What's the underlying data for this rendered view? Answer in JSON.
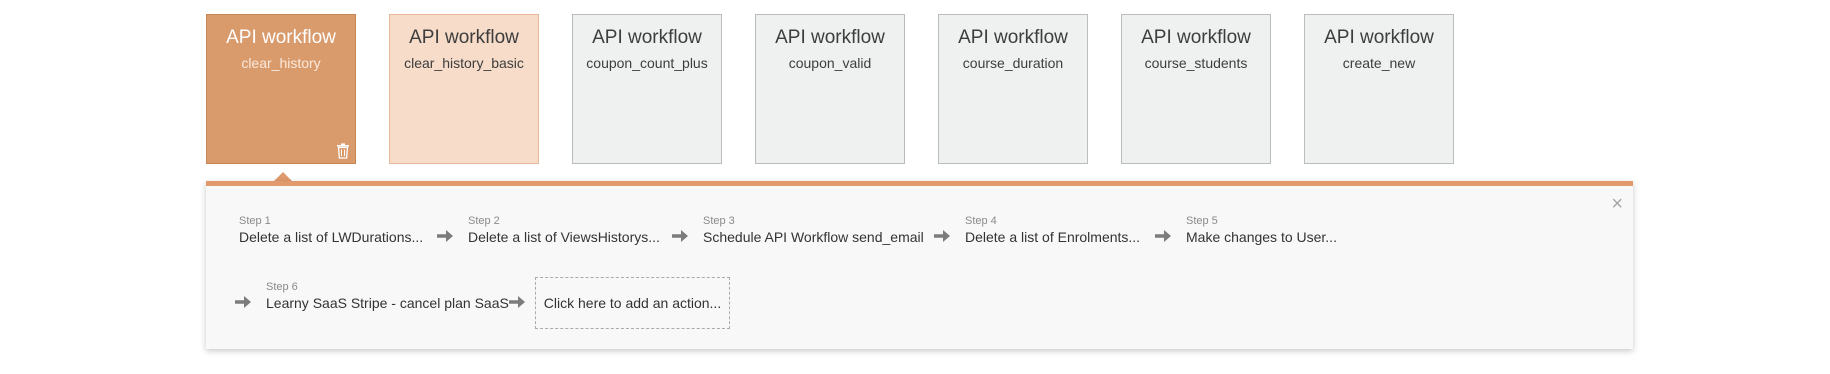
{
  "workflows": [
    {
      "title": "API workflow",
      "name": "clear_history",
      "state": "selected"
    },
    {
      "title": "API workflow",
      "name": "clear_history_basic",
      "state": "hover"
    },
    {
      "title": "API workflow",
      "name": "coupon_count_plus",
      "state": "default"
    },
    {
      "title": "API workflow",
      "name": "coupon_valid",
      "state": "default"
    },
    {
      "title": "API workflow",
      "name": "course_duration",
      "state": "default"
    },
    {
      "title": "API workflow",
      "name": "course_students",
      "state": "default"
    },
    {
      "title": "API workflow",
      "name": "create_new",
      "state": "default"
    }
  ],
  "panel": {
    "close_label": "×",
    "steps": [
      {
        "num": "Step 1",
        "text": "Delete a list of LWDurations..."
      },
      {
        "num": "Step 2",
        "text": "Delete a list of ViewsHistorys..."
      },
      {
        "num": "Step 3",
        "text": "Schedule API Workflow send_email"
      },
      {
        "num": "Step 4",
        "text": "Delete a list of Enrolments..."
      },
      {
        "num": "Step 5",
        "text": "Make changes to User..."
      },
      {
        "num": "Step 6",
        "text": "Learny SaaS Stripe - cancel plan SaaS"
      }
    ],
    "add_action": "Click here to add an action..."
  },
  "colors": {
    "accent": "#e09a6c",
    "selected_card": "#d99a6c",
    "hover_card": "#f6dcc9",
    "default_card": "#eff1f1"
  },
  "icons": {
    "trash": "trash-icon",
    "arrow": "arrow-right-icon",
    "close": "close-icon"
  }
}
